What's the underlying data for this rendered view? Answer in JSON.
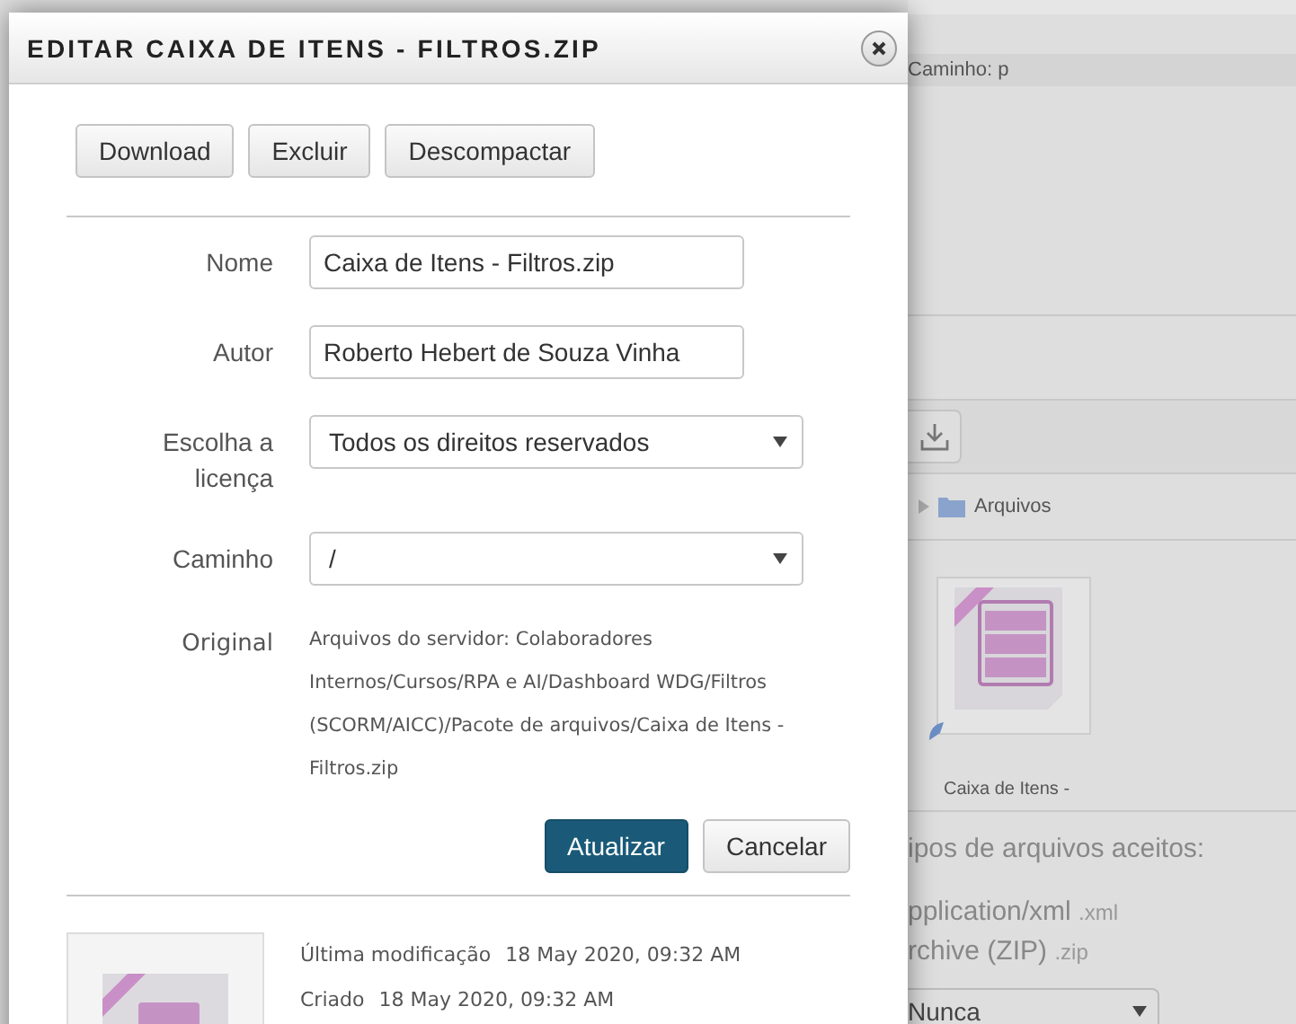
{
  "background": {
    "path_bar": "Caminho: p",
    "breadcrumb": "Arquivos",
    "file_label": "Caixa de Itens -",
    "accepted_heading": "ipos de arquivos aceitos:",
    "accepted_types": [
      {
        "name": "pplication/xml",
        "ext": ".xml"
      },
      {
        "name": "rchive (ZIP)",
        "ext": ".zip"
      }
    ],
    "select_value": "Nunca"
  },
  "dialog": {
    "title": "EDITAR CAIXA DE ITENS - FILTROS.ZIP",
    "actions": [
      "Download",
      "Excluir",
      "Descompactar"
    ],
    "fields": [
      {
        "kind": "text",
        "label": "Nome",
        "value": "Caixa de Itens - Filtros.zip"
      },
      {
        "kind": "text",
        "label": "Autor",
        "value": "Roberto Hebert de Souza Vinha"
      },
      {
        "kind": "select",
        "label": "Escolha a licença",
        "value": "Todos os direitos reservados"
      },
      {
        "kind": "select",
        "label": "Caminho",
        "value": "/"
      },
      {
        "kind": "info",
        "label": "Original",
        "value": "Arquivos do servidor: Colaboradores Internos/Cursos/RPA e AI/Dashboard WDG/Filtros (SCORM/AICC)/Pacote de arquivos/Caixa de Itens - Filtros.zip"
      }
    ],
    "submit": "Atualizar",
    "cancel": "Cancelar",
    "details": [
      {
        "label": "Última modificação",
        "value": "18 May 2020, 09:32 AM"
      },
      {
        "label": "Criado",
        "value": "18 May 2020, 09:32 AM"
      }
    ]
  }
}
